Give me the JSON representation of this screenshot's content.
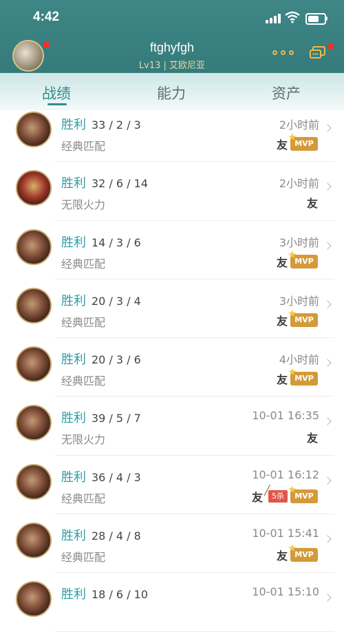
{
  "status_bar": {
    "time": "4:42",
    "icons": [
      "signal-icon",
      "wifi-icon",
      "battery-icon"
    ]
  },
  "header": {
    "username": "ftghyfgh",
    "subinfo": "Lv13 | 艾欧尼亚",
    "more_icon": "more-dots-icon",
    "chat_icon": "chat-icon"
  },
  "tabs": [
    {
      "label": "战绩",
      "active": true
    },
    {
      "label": "能力",
      "active": false
    },
    {
      "label": "资产",
      "active": false
    }
  ],
  "matches": [
    {
      "result": "胜利",
      "kda": "33 / 2 / 3",
      "mode": "经典匹配",
      "time": "2小时前",
      "friend": "友",
      "mvp": "MVP",
      "kill_badge": "",
      "avatar": "champion-avatar"
    },
    {
      "result": "胜利",
      "kda": "32 / 6 / 14",
      "mode": "无限火力",
      "time": "2小时前",
      "friend": "友",
      "mvp": "",
      "kill_badge": "",
      "avatar": "champion-avatar-alt"
    },
    {
      "result": "胜利",
      "kda": "14 / 3 / 6",
      "mode": "经典匹配",
      "time": "3小时前",
      "friend": "友",
      "mvp": "MVP",
      "kill_badge": "",
      "avatar": "champion-avatar"
    },
    {
      "result": "胜利",
      "kda": "20 / 3 / 4",
      "mode": "经典匹配",
      "time": "3小时前",
      "friend": "友",
      "mvp": "MVP",
      "kill_badge": "",
      "avatar": "champion-avatar"
    },
    {
      "result": "胜利",
      "kda": "20 / 3 / 6",
      "mode": "经典匹配",
      "time": "4小时前",
      "friend": "友",
      "mvp": "MVP",
      "kill_badge": "",
      "avatar": "champion-avatar"
    },
    {
      "result": "胜利",
      "kda": "39 / 5 / 7",
      "mode": "无限火力",
      "time": "10-01 16:35",
      "friend": "友",
      "mvp": "",
      "kill_badge": "",
      "avatar": "champion-avatar"
    },
    {
      "result": "胜利",
      "kda": "36 / 4 / 3",
      "mode": "经典匹配",
      "time": "10-01 16:12",
      "friend": "友",
      "mvp": "MVP",
      "kill_badge": "5杀",
      "avatar": "champion-avatar"
    },
    {
      "result": "胜利",
      "kda": "28 / 4 / 8",
      "mode": "经典匹配",
      "time": "10-01 15:41",
      "friend": "友",
      "mvp": "MVP",
      "kill_badge": "",
      "avatar": "champion-avatar"
    },
    {
      "result": "胜利",
      "kda": "18 / 6 / 10",
      "mode": "",
      "time": "10-01 15:10",
      "friend": "",
      "mvp": "",
      "kill_badge": "",
      "avatar": "champion-avatar"
    }
  ]
}
